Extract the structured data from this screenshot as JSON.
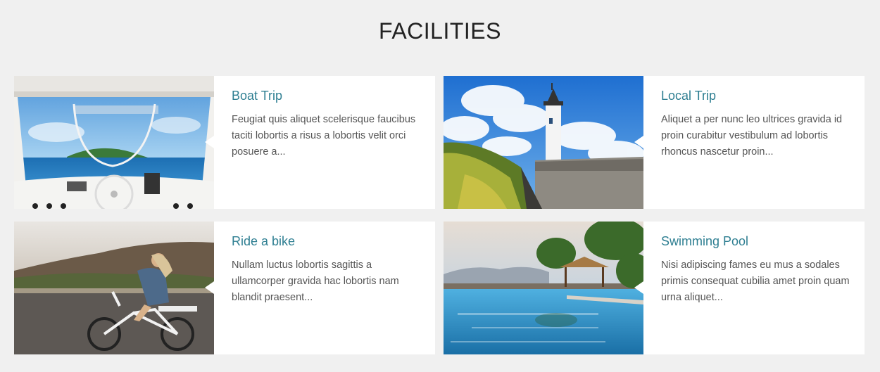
{
  "section": {
    "title": "FACILITIES"
  },
  "cards": [
    {
      "title": "Boat Trip",
      "text": "Feugiat quis aliquet scelerisque faucibus taciti lobortis a risus a lobortis velit orci posuere a..."
    },
    {
      "title": "Local Trip",
      "text": "Aliquet a per nunc leo ultrices gravida id proin curabitur vestibulum ad lobortis rhoncus nascetur proin..."
    },
    {
      "title": "Ride a bike",
      "text": "Nullam luctus lobortis sagittis a ullamcorper gravida hac lobortis nam blandit praesent..."
    },
    {
      "title": "Swimming Pool",
      "text": "Nisi adipiscing fames eu mus a sodales primis consequat cubilia amet proin quam urna aliquet..."
    }
  ]
}
